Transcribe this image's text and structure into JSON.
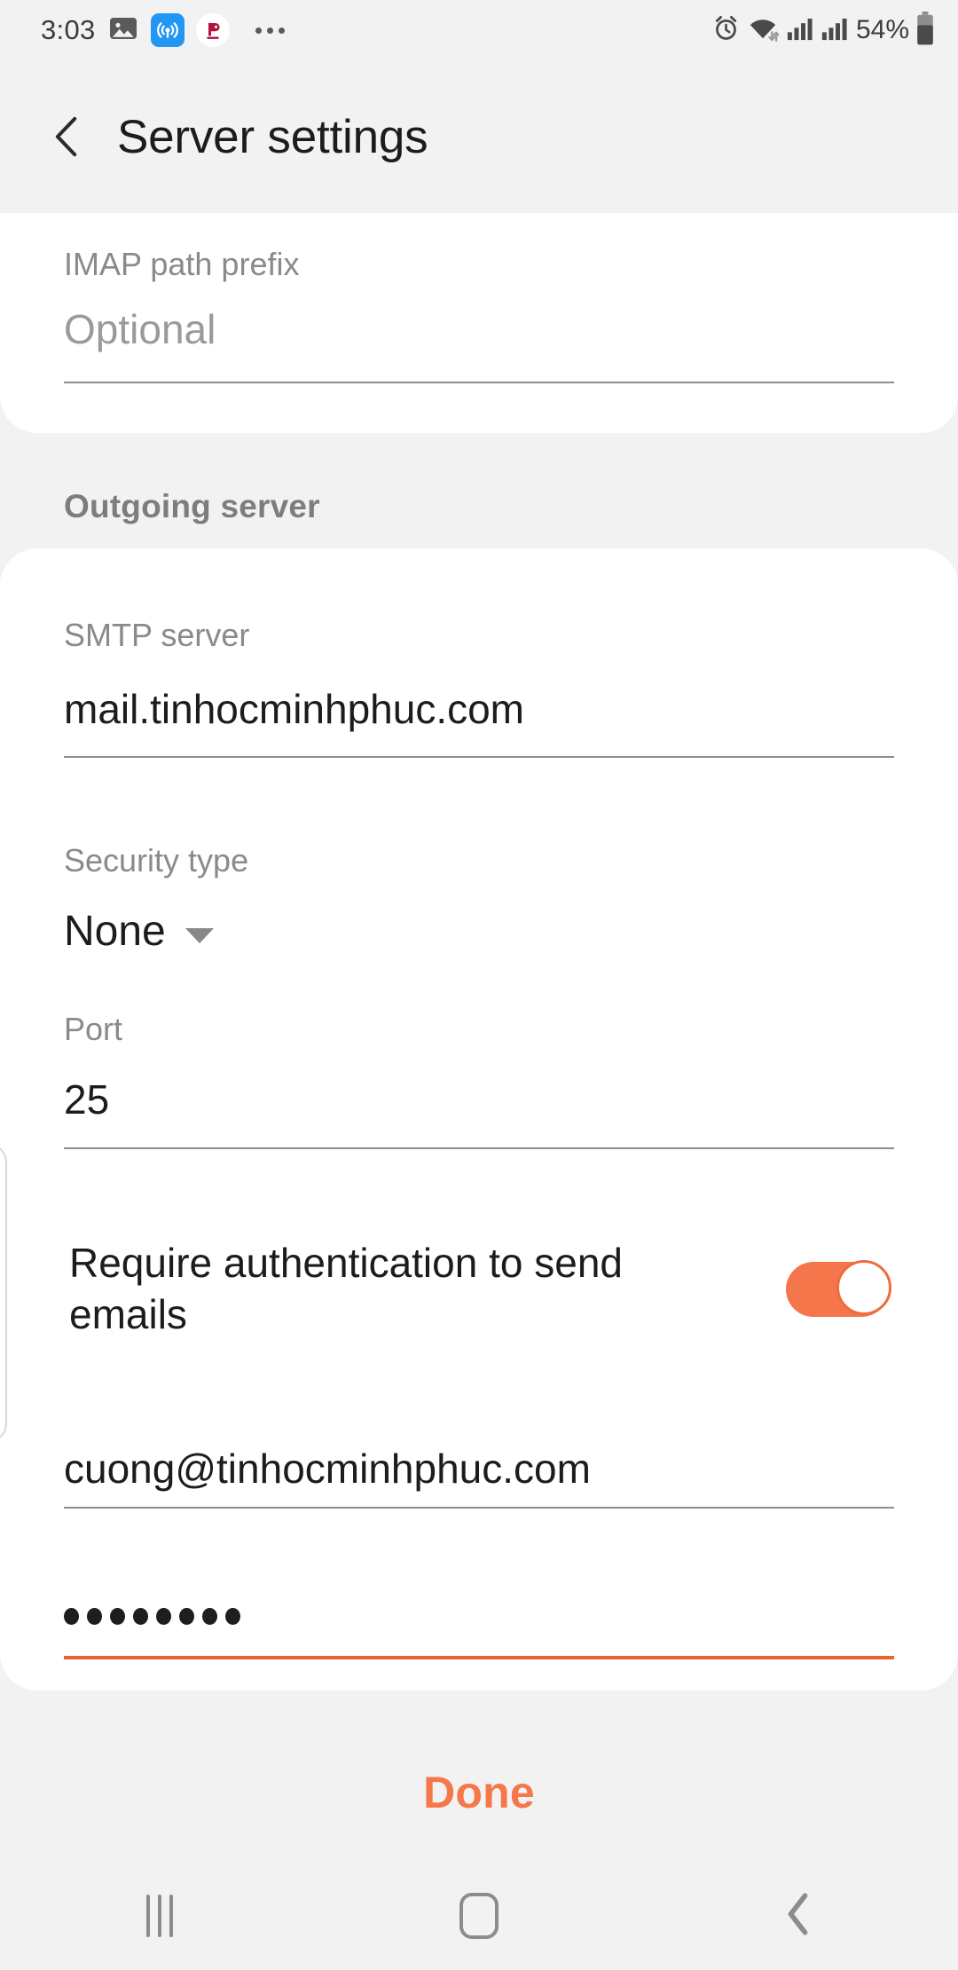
{
  "statusbar": {
    "time": "3:03",
    "battery_percent": "54%",
    "icons": [
      "image-icon",
      "hotspot-icon",
      "app-badge-icon",
      "more-notifications-icon",
      "alarm-icon",
      "wifi-icon",
      "signal-icon-1",
      "signal-icon-2",
      "battery-icon"
    ]
  },
  "appbar": {
    "title": "Server settings",
    "back_icon": "chevron-left-icon"
  },
  "imap_section": {
    "fields": [
      {
        "label": "IMAP path prefix",
        "value": "",
        "placeholder": "Optional"
      }
    ]
  },
  "outgoing_section": {
    "header": "Outgoing server",
    "smtp": {
      "label": "SMTP server",
      "value": "mail.tinhocminhphuc.com"
    },
    "security": {
      "label": "Security type",
      "value": "None",
      "caret_icon": "chevron-down-icon",
      "options": [
        "None"
      ]
    },
    "port": {
      "label": "Port",
      "value": "25"
    },
    "require_auth": {
      "label": "Require authentication to send emails",
      "enabled": true
    },
    "username": {
      "value": "cuong@tinhocminhphuc.com"
    },
    "password": {
      "masked_length": 8,
      "focused": true
    }
  },
  "footer": {
    "done_label": "Done"
  },
  "navbar": {
    "recents_icon": "recents-icon",
    "home_icon": "home-icon",
    "back_icon": "chevron-left-icon"
  },
  "colors": {
    "accent": "#f5774a",
    "toggle_on": "#f4764a",
    "field_underline": "#8d8d8d",
    "focus_underline": "#e8622c",
    "page_bg": "#f2f2f2",
    "card_bg": "#ffffff",
    "label_gray": "#8a8a8a",
    "text_dark": "#1c1c1c"
  }
}
